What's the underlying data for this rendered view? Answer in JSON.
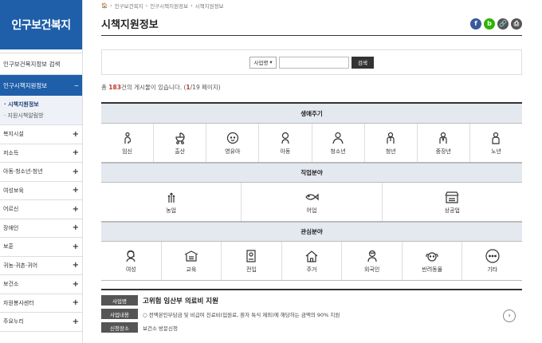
{
  "sidebar": {
    "brand": "인구보건복지",
    "search_item": "인구보건복지정보 검색",
    "active": {
      "label": "인구시책지원정보",
      "toggle": "−"
    },
    "sub_items": [
      {
        "label": "· 시책지원정보"
      },
      {
        "label": "· 지원시책알림방"
      }
    ],
    "items": [
      {
        "label": "복지시설",
        "toggle": "+"
      },
      {
        "label": "저소득",
        "toggle": "+"
      },
      {
        "label": "아동·청소년·청년",
        "toggle": "+"
      },
      {
        "label": "여성보육",
        "toggle": "+"
      },
      {
        "label": "어르신",
        "toggle": "+"
      },
      {
        "label": "장애인",
        "toggle": "+"
      },
      {
        "label": "보훈",
        "toggle": "+"
      },
      {
        "label": "귀농·귀촌·귀어",
        "toggle": "+"
      },
      {
        "label": "보건소",
        "toggle": "+"
      },
      {
        "label": "자원봉사센터",
        "toggle": "+"
      },
      {
        "label": "주요누리",
        "toggle": "+"
      }
    ]
  },
  "breadcrumb": [
    "인구보건복지",
    "인구시책지원정보",
    "시책지원정보"
  ],
  "page_title": "시책지원정보",
  "search": {
    "select_value": "사업명",
    "button": "검색"
  },
  "count": {
    "prefix": "총 ",
    "total": "183",
    "mid": "건의 게시물이 있습니다. (",
    "page": "1",
    "suffix": "/19 페이지)"
  },
  "sections": [
    {
      "header": "생애주기",
      "items": [
        "임신",
        "출산",
        "영유아",
        "아동",
        "청소년",
        "청년",
        "중장년",
        "노년"
      ]
    },
    {
      "header": "직업분야",
      "items": [
        "농업",
        "어업",
        "상공업"
      ]
    },
    {
      "header": "관심분야",
      "items": [
        "여성",
        "교육",
        "전입",
        "주거",
        "외국인",
        "반려동물",
        "기타"
      ]
    }
  ],
  "result": {
    "tag_name": "사업명",
    "name": "고위험 임산부 의료비 지원",
    "tag_content": "사업내용",
    "content": "○ 전액본인부담금 및 비급여 진료비(입원료, 환자 특식 제외)에 해당하는 금액의 90% 지원",
    "tag_place": "신청장소",
    "place": "보건소 방문신청"
  },
  "colors": {
    "brand": "#1f5fa9",
    "accent": "#c0392b"
  }
}
